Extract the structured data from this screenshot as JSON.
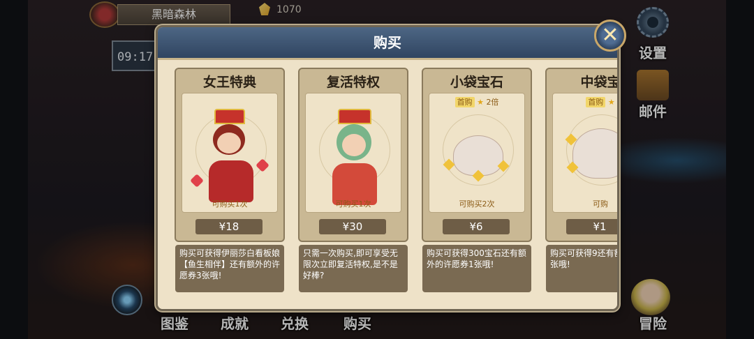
{
  "hud": {
    "location": "黑暗森林",
    "currency_icon": "gem-icon",
    "currency": "1070",
    "time": "09:17"
  },
  "right_menu": {
    "settings": "设置",
    "mail": "邮件",
    "adventure": "冒险"
  },
  "bottom_nav": [
    "图鉴",
    "成就",
    "兑换",
    "购买"
  ],
  "modal": {
    "title": "购买",
    "close_glyph": "✕",
    "products": [
      {
        "title": "女王特典",
        "first_purchase": null,
        "limit": "可购买1次",
        "price": "¥18",
        "description": "购买可获得伊丽莎白看板娘【鱼生相伴】还有额外的许愿券3张哦!"
      },
      {
        "title": "复活特权",
        "first_purchase": null,
        "limit": "可购买1次",
        "price": "¥30",
        "description": "只需一次购买,即可享受无限次立即复活特权,是不是好棒?"
      },
      {
        "title": "小袋宝石",
        "first_purchase": {
          "tag": "首购",
          "bonus": "2倍"
        },
        "limit": "可购买2次",
        "price": "¥6",
        "description": "购买可获得300宝石还有额外的许愿券1张哦!"
      },
      {
        "title": "中袋宝",
        "first_purchase": {
          "tag": "首购",
          "bonus": ""
        },
        "limit": "可购",
        "price": "¥1",
        "description": "购买可获得9还有额外的许张哦!"
      }
    ],
    "scroll_progress": 0.58
  }
}
